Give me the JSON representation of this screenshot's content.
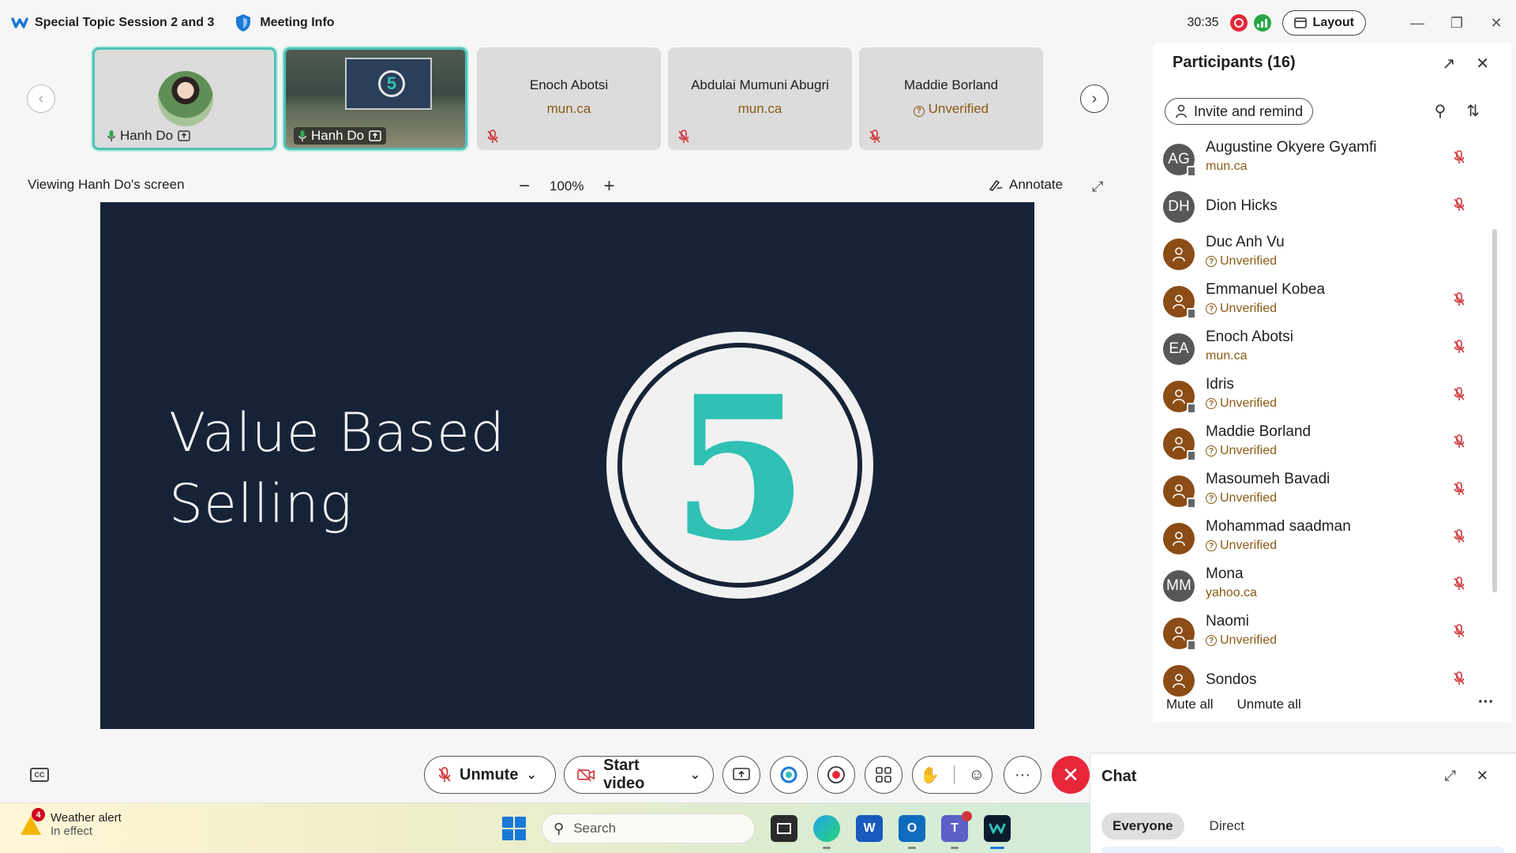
{
  "titlebar": {
    "meeting_title": "Special Topic Session 2 and 3",
    "meeting_info_label": "Meeting Info",
    "timer": "30:35",
    "layout_label": "Layout"
  },
  "thumbnails": [
    {
      "name": "Hanh Do",
      "type": "video",
      "active": true
    },
    {
      "name": "Hanh Do",
      "type": "share",
      "active": true
    },
    {
      "name": "Enoch Abotsi",
      "domain": "mun.ca",
      "type": "placeholder"
    },
    {
      "name": "Abdulai Mumuni Abugri",
      "domain": "mun.ca",
      "type": "placeholder"
    },
    {
      "name": "Maddie Borland",
      "domain": "Unverified",
      "type": "placeholder"
    }
  ],
  "viewing": {
    "label": "Viewing Hanh Do's screen",
    "zoom": "100%",
    "annotate_label": "Annotate"
  },
  "slide": {
    "title_line1": "Value Based",
    "title_line2": "Selling",
    "badge_number": "5"
  },
  "controls": {
    "unmute_label": "Unmute",
    "start_video_label": "Start video",
    "more_label": "···"
  },
  "participants": {
    "title": "Participants (16)",
    "invite_label": "Invite and remind",
    "mute_all_label": "Mute all",
    "unmute_all_label": "Unmute all",
    "list": [
      {
        "name": "Augustine Okyere Gyamfi",
        "sub": "mun.ca",
        "avatar": "AG",
        "kind": "initials",
        "device": true,
        "muted": true
      },
      {
        "name": "Dion Hicks",
        "sub": "",
        "avatar": "DH",
        "kind": "initials",
        "device": false,
        "muted": true
      },
      {
        "name": "Duc Anh Vu",
        "sub": "Unverified",
        "avatar": "",
        "kind": "guest",
        "device": false,
        "muted": false
      },
      {
        "name": "Emmanuel Kobea",
        "sub": "Unverified",
        "avatar": "",
        "kind": "guest",
        "device": true,
        "muted": true
      },
      {
        "name": "Enoch Abotsi",
        "sub": "mun.ca",
        "avatar": "EA",
        "kind": "initials",
        "device": false,
        "muted": true
      },
      {
        "name": "Idris",
        "sub": "Unverified",
        "avatar": "",
        "kind": "guest",
        "device": true,
        "muted": true
      },
      {
        "name": "Maddie Borland",
        "sub": "Unverified",
        "avatar": "",
        "kind": "guest",
        "device": true,
        "muted": true
      },
      {
        "name": "Masoumeh Bavadi",
        "sub": "Unverified",
        "avatar": "",
        "kind": "guest",
        "device": true,
        "muted": true
      },
      {
        "name": "Mohammad saadman",
        "sub": "Unverified",
        "avatar": "",
        "kind": "guest",
        "device": false,
        "muted": true
      },
      {
        "name": "Mona",
        "sub": "yahoo.ca",
        "avatar": "MM",
        "kind": "initials",
        "device": false,
        "muted": true
      },
      {
        "name": "Naomi",
        "sub": "Unverified",
        "avatar": "",
        "kind": "guest",
        "device": true,
        "muted": true
      },
      {
        "name": "Sondos",
        "sub": "",
        "avatar": "",
        "kind": "guest",
        "device": false,
        "muted": true
      }
    ]
  },
  "chat": {
    "title": "Chat",
    "tab_everyone": "Everyone",
    "tab_direct": "Direct"
  },
  "taskbar": {
    "weather_badge": "4",
    "weather_title": "Weather alert",
    "weather_sub": "In effect",
    "search_placeholder": "Search"
  },
  "colors": {
    "accent_teal": "#2fc1b4",
    "slide_bg": "#162337",
    "end_call_red": "#e8263a",
    "muted_red": "#d13438",
    "domain_brown": "#8a5a14"
  }
}
